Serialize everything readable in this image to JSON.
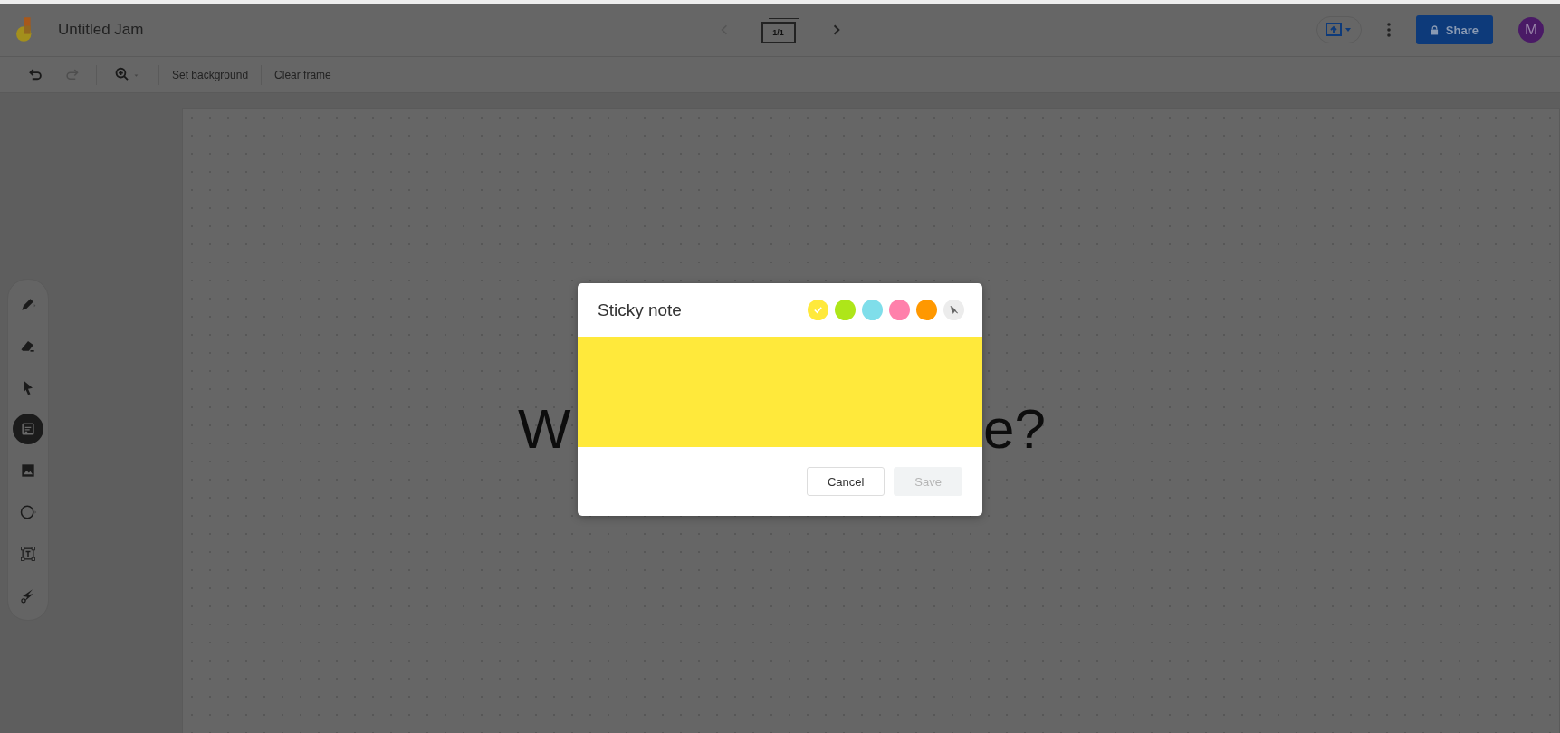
{
  "app": {
    "title": "Untitled Jam"
  },
  "frame_nav": {
    "label": "1/1",
    "previous": {
      "disabled": true
    },
    "next": {
      "disabled": false
    }
  },
  "header_actions": {
    "share": "Share",
    "avatar": "M"
  },
  "toolbar": {
    "undo": {
      "disabled": false
    },
    "redo": {
      "disabled": true
    },
    "buttons": [
      "Set background",
      "Clear frame"
    ]
  },
  "tools": [
    {
      "kind": "pen",
      "selected": false
    },
    {
      "kind": "eraser",
      "selected": false
    },
    {
      "kind": "select",
      "selected": false
    },
    {
      "kind": "sticky",
      "selected": true
    },
    {
      "kind": "image",
      "selected": false
    },
    {
      "kind": "circle",
      "selected": false
    },
    {
      "kind": "textbox",
      "selected": false
    },
    {
      "kind": "laser",
      "selected": false
    }
  ],
  "frame_text_fragments": [
    "W",
    "e?"
  ],
  "dialog": {
    "title": "Sticky note",
    "colors": [
      {
        "color": "#ffe93b",
        "selected": true
      },
      {
        "color": "#aee619",
        "selected": false
      },
      {
        "color": "#7fdeea",
        "selected": false
      },
      {
        "color": "#ff80ab",
        "selected": false
      },
      {
        "color": "#ff9800",
        "selected": false
      }
    ],
    "buttons": [
      {
        "label": "Cancel",
        "disabled": false
      },
      {
        "label": "Save",
        "disabled": true
      }
    ]
  }
}
